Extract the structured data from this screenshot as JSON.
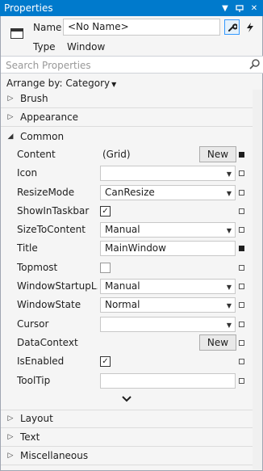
{
  "window": {
    "title": "Properties"
  },
  "header": {
    "name_label": "Name",
    "name_value": "<No Name>",
    "type_label": "Type",
    "type_value": "Window"
  },
  "search": {
    "placeholder": "Search Properties"
  },
  "arrange": {
    "label": "Arrange by: Category"
  },
  "categories_top": [
    {
      "label": "Brush",
      "expanded": false
    },
    {
      "label": "Appearance",
      "expanded": false
    },
    {
      "label": "Common",
      "expanded": true
    }
  ],
  "properties": [
    {
      "label": "Content",
      "kind": "text_button",
      "value": "(Grid)",
      "button": "New",
      "set": true
    },
    {
      "label": "Icon",
      "kind": "dropdown",
      "value": "",
      "set": false
    },
    {
      "label": "ResizeMode",
      "kind": "dropdown",
      "value": "CanResize",
      "set": false
    },
    {
      "label": "ShowInTaskbar",
      "kind": "checkbox",
      "checked": true,
      "set": false
    },
    {
      "label": "SizeToContent",
      "kind": "dropdown",
      "value": "Manual",
      "set": false
    },
    {
      "label": "Title",
      "kind": "text",
      "value": "MainWindow",
      "set": true
    },
    {
      "label": "Topmost",
      "kind": "checkbox",
      "checked": false,
      "set": false
    },
    {
      "label": "WindowStartupL...",
      "kind": "dropdown",
      "value": "Manual",
      "set": false
    },
    {
      "label": "WindowState",
      "kind": "dropdown",
      "value": "Normal",
      "set": false
    },
    {
      "label": "Cursor",
      "kind": "dropdown",
      "value": "",
      "set": false
    },
    {
      "label": "DataContext",
      "kind": "button",
      "button": "New",
      "set": false
    },
    {
      "label": "IsEnabled",
      "kind": "checkbox",
      "checked": true,
      "set": false
    },
    {
      "label": "ToolTip",
      "kind": "text",
      "value": "",
      "set": false
    }
  ],
  "categories_bottom": [
    {
      "label": "Layout",
      "expanded": false
    },
    {
      "label": "Text",
      "expanded": false
    },
    {
      "label": "Miscellaneous",
      "expanded": false
    }
  ],
  "icons": {
    "title_dropdown": "chevron-down-icon",
    "pin": "pin-icon",
    "close": "close-icon",
    "properties_tab": "wrench-icon",
    "events_tab": "lightning-icon",
    "search": "search-icon",
    "expand_more": "chevron-down-icon"
  },
  "colors": {
    "accent": "#007acc"
  }
}
